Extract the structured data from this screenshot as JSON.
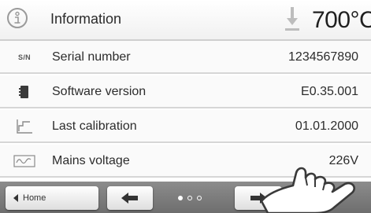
{
  "header": {
    "title": "Information",
    "temperature": "700°C",
    "info_icon": "info-icon",
    "temp_icon": "temperature-arrow-icon"
  },
  "rows": [
    {
      "icon": "sn-icon",
      "icon_text": "S/N",
      "label": "Serial number",
      "value": "1234567890"
    },
    {
      "icon": "software-chip-icon",
      "label": "Software version",
      "value": "E0.35.001"
    },
    {
      "icon": "calibration-curve-icon",
      "label": "Last calibration",
      "value": "01.01.2000"
    },
    {
      "icon": "mains-voltage-icon",
      "label": "Mains voltage",
      "value": "226V"
    }
  ],
  "nav": {
    "home_label": "Home",
    "pager": {
      "total": 3,
      "active": 1
    }
  },
  "colors": {
    "nav_bar": "#7d7d7d",
    "row_background": "#fafafa",
    "divider": "#d6d6d6"
  }
}
